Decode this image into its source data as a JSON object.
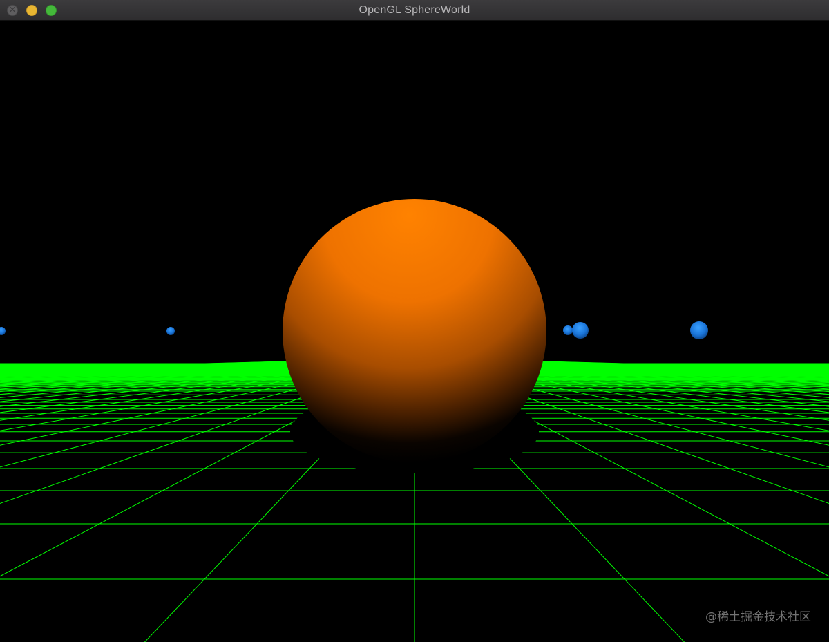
{
  "window": {
    "title": "OpenGL SphereWorld",
    "controls": [
      "close",
      "minimize",
      "zoom"
    ]
  },
  "scene": {
    "background_color": "#000000",
    "grid_color": "#00ff00",
    "main_sphere": {
      "color": "#ff7f00",
      "icon": "sphere-torus-icon"
    },
    "small_spheres": {
      "color": "#1e90ff",
      "count": 5
    }
  },
  "watermark": {
    "text": "@稀土掘金技术社区"
  }
}
